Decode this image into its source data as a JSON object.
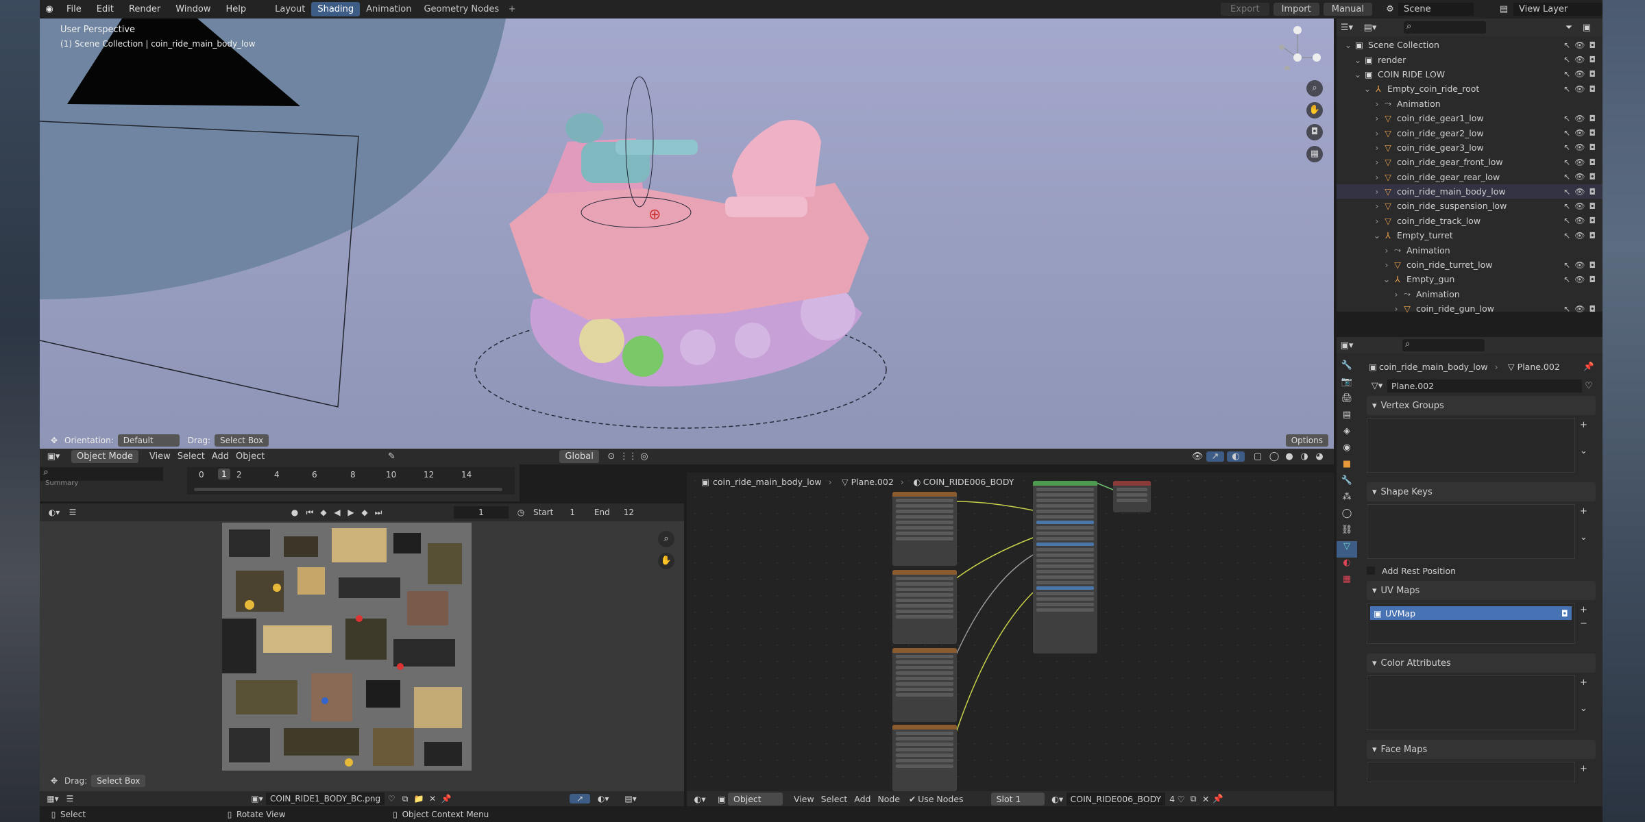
{
  "menu": {
    "file": "File",
    "edit": "Edit",
    "render": "Render",
    "window": "Window",
    "help": "Help"
  },
  "workspaces": [
    {
      "label": "Layout",
      "active": false
    },
    {
      "label": "Shading",
      "active": true
    },
    {
      "label": "Animation",
      "active": false
    },
    {
      "label": "Geometry Nodes",
      "active": false
    }
  ],
  "topright": {
    "export": "Export",
    "import": "Import",
    "manual": "Manual",
    "scene": "Scene",
    "view_layer": "View Layer"
  },
  "viewport": {
    "perspective": "User Perspective",
    "collection": "(1) Scene Collection | coin_ride_main_body_low",
    "orientation_label": "Orientation:",
    "orientation_value": "Default",
    "drag_label": "Drag:",
    "drag_value": "Select Box",
    "options": "Options"
  },
  "viewport_header": {
    "mode": "Object Mode",
    "view": "View",
    "select": "Select",
    "add": "Add",
    "object": "Object",
    "transform": "Global"
  },
  "timeline": {
    "ticks": [
      "0",
      "1",
      "2",
      "4",
      "6",
      "8",
      "10",
      "12",
      "14"
    ],
    "current": "1",
    "start_label": "Start",
    "start": "1",
    "end_label": "End",
    "end": "12",
    "summary": "Summary"
  },
  "image_editor": {
    "drag_label": "Drag:",
    "drag_value": "Select Box",
    "image_name": "COIN_RIDE1_BODY_BC.png"
  },
  "node_editor": {
    "breadcrumb": [
      "coin_ride_main_body_low",
      "Plane.002",
      "COIN_RIDE006_BODY"
    ],
    "object_mode": "Object",
    "view": "View",
    "select": "Select",
    "add": "Add",
    "node": "Node",
    "use_nodes": "Use Nodes",
    "slot": "Slot 1",
    "material": "COIN_RIDE006_BODY",
    "users": "4"
  },
  "outliner": {
    "rows": [
      {
        "label": "Scene Collection",
        "indent": 0,
        "icon": "collection-icon"
      },
      {
        "label": "render",
        "indent": 1,
        "icon": "collection-icon"
      },
      {
        "label": "COIN RIDE LOW",
        "indent": 1,
        "icon": "collection-icon"
      },
      {
        "label": "Empty_coin_ride_root",
        "indent": 2,
        "icon": "empty-icon"
      },
      {
        "label": "Animation",
        "indent": 3,
        "icon": "action-icon"
      },
      {
        "label": "coin_ride_gear1_low",
        "indent": 3,
        "icon": "mesh-icon"
      },
      {
        "label": "coin_ride_gear2_low",
        "indent": 3,
        "icon": "mesh-icon"
      },
      {
        "label": "coin_ride_gear3_low",
        "indent": 3,
        "icon": "mesh-icon"
      },
      {
        "label": "coin_ride_gear_front_low",
        "indent": 3,
        "icon": "mesh-icon"
      },
      {
        "label": "coin_ride_gear_rear_low",
        "indent": 3,
        "icon": "mesh-icon"
      },
      {
        "label": "coin_ride_main_body_low",
        "indent": 3,
        "icon": "mesh-icon"
      },
      {
        "label": "coin_ride_suspension_low",
        "indent": 3,
        "icon": "mesh-icon"
      },
      {
        "label": "coin_ride_track_low",
        "indent": 3,
        "icon": "mesh-icon"
      },
      {
        "label": "Empty_turret",
        "indent": 3,
        "icon": "empty-icon"
      },
      {
        "label": "Animation",
        "indent": 4,
        "icon": "action-icon"
      },
      {
        "label": "coin_ride_turret_low",
        "indent": 4,
        "icon": "mesh-icon"
      },
      {
        "label": "Empty_gun",
        "indent": 4,
        "icon": "empty-icon"
      },
      {
        "label": "Animation",
        "indent": 5,
        "icon": "action-icon"
      },
      {
        "label": "coin_ride_gun_low",
        "indent": 5,
        "icon": "mesh-icon"
      }
    ]
  },
  "properties": {
    "object": "coin_ride_main_body_low",
    "mesh": "Plane.002",
    "mesh_field": "Plane.002",
    "vertex_groups": "Vertex Groups",
    "shape_keys": "Shape Keys",
    "add_rest_position": "Add Rest Position",
    "uv_maps": "UV Maps",
    "uv_map_item": "UVMap",
    "color_attributes": "Color Attributes",
    "face_maps": "Face Maps"
  },
  "status": {
    "select": "Select",
    "rotate": "Rotate View",
    "context": "Object Context Menu"
  }
}
